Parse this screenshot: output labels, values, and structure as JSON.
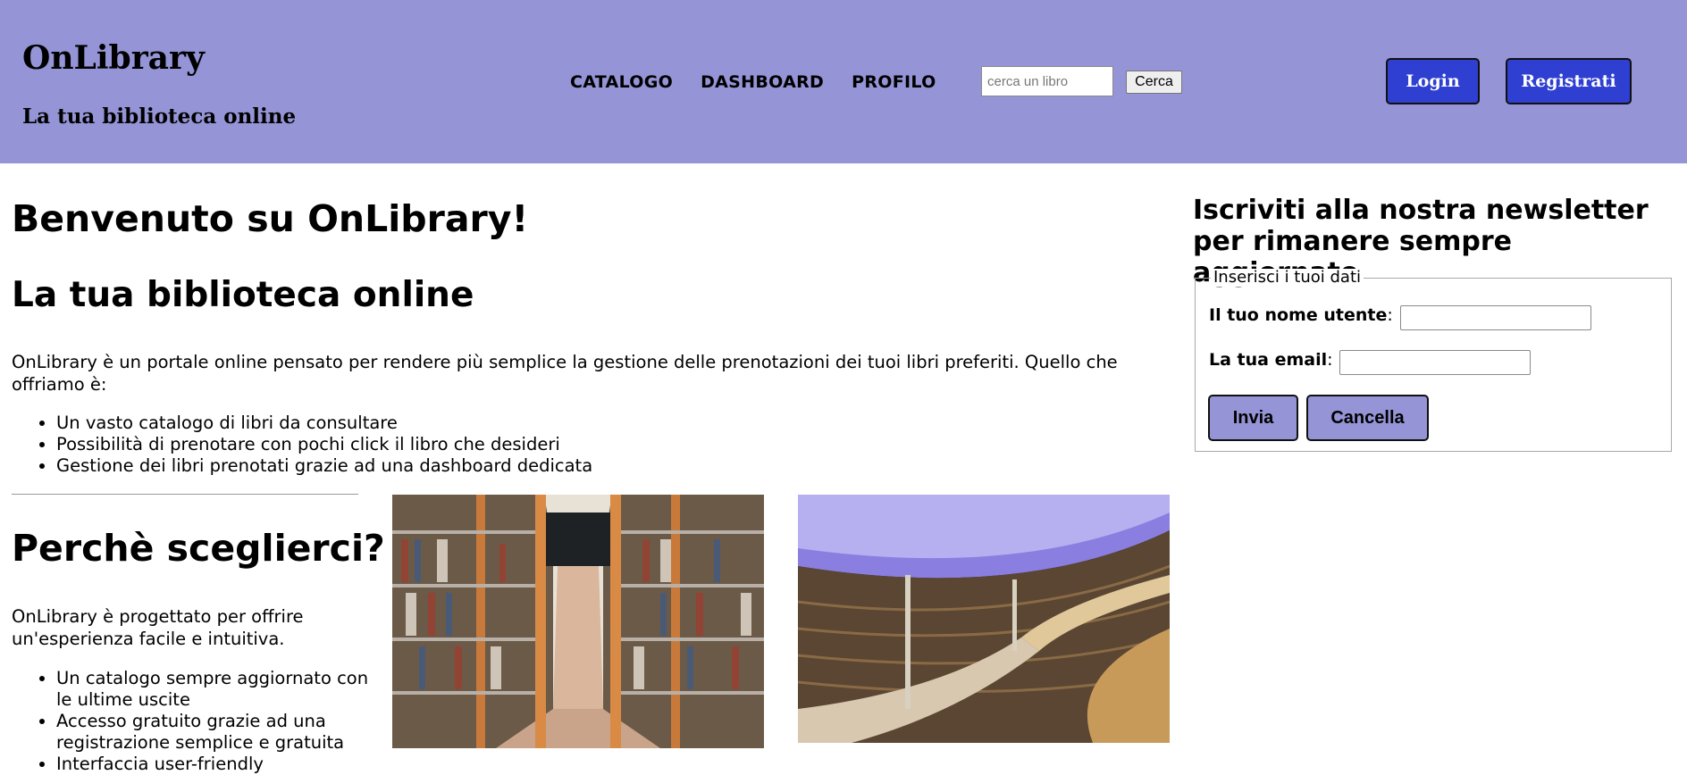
{
  "header": {
    "brand_title": "OnLibrary",
    "brand_subtitle": "La tua biblioteca online",
    "nav": [
      "CATALOGO",
      "DASHBOARD",
      "PROFILO"
    ],
    "search_placeholder": "cerca un libro",
    "search_value": "",
    "search_button": "Cerca",
    "login_label": "Login",
    "register_label": "Registrati",
    "background_color": "#9494d6",
    "button_color": "#2f3fd1"
  },
  "main": {
    "welcome": "Benvenuto su OnLibrary!",
    "subtitle": "La tua biblioteca online",
    "intro": "OnLibrary è un portale online pensato per rendere più semplice la gestione delle prenotazioni dei tuoi libri preferiti. Quello che offriamo è:",
    "features": [
      "Un vasto catalogo di libri da consultare",
      "Possibilità di prenotare con pochi click il libro che desideri",
      "Gestione dei libri prenotati grazie ad una dashboard dedicata"
    ],
    "why_title": "Perchè sceglierci?",
    "why_text": "OnLibrary è progettato per offrire un'esperienza facile e intuitiva.",
    "why_list": [
      "Un catalogo sempre aggiornato con le ultime uscite",
      "Accesso gratuito grazie ad una registrazione semplice e gratuita",
      "Interfaccia user-friendly"
    ]
  },
  "newsletter": {
    "title": "Iscriviti alla nostra newsletter per rimanere sempre aggiornato",
    "legend": "Inserisci i tuoi dati",
    "username_label": "Il tuo nome utente",
    "email_label": "La tua email",
    "colon": ":",
    "username_value": "",
    "email_value": "",
    "send_label": "Invia",
    "cancel_label": "Cancella",
    "button_color": "#9494d6"
  }
}
